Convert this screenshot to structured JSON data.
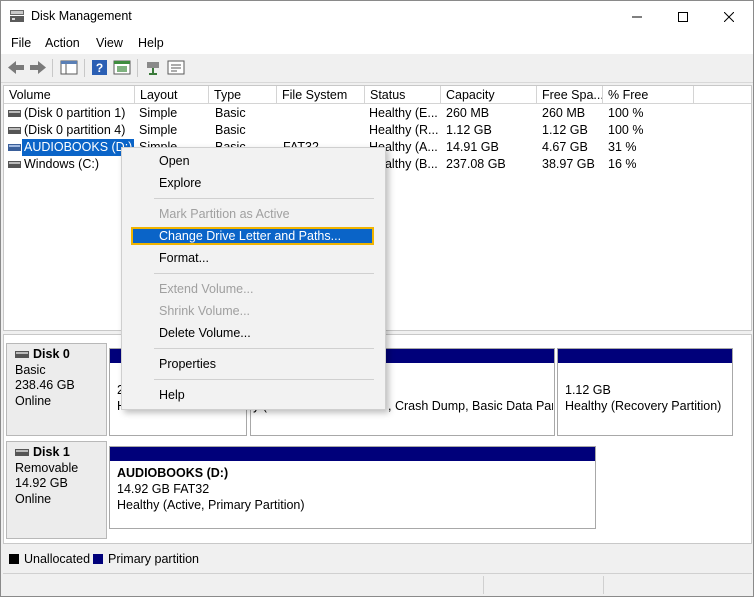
{
  "window": {
    "title": "Disk Management"
  },
  "menubar": [
    "File",
    "Action",
    "View",
    "Help"
  ],
  "volume_list": {
    "columns": [
      "Volume",
      "Layout",
      "Type",
      "File System",
      "Status",
      "Capacity",
      "Free Spa...",
      "% Free"
    ],
    "rows": [
      {
        "volume": "(Disk 0 partition 1)",
        "layout": "Simple",
        "type": "Basic",
        "fs": "",
        "status": "Healthy (E...",
        "capacity": "260 MB",
        "free": "260 MB",
        "pct": "100 %"
      },
      {
        "volume": "(Disk 0 partition 4)",
        "layout": "Simple",
        "type": "Basic",
        "fs": "",
        "status": "Healthy (R...",
        "capacity": "1.12 GB",
        "free": "1.12 GB",
        "pct": "100 %"
      },
      {
        "volume": "AUDIOBOOKS (D:)",
        "layout": "Simple",
        "type": "Basic",
        "fs": "FAT32",
        "status": "Healthy (A...",
        "capacity": "14.91 GB",
        "free": "4.67 GB",
        "pct": "31 %"
      },
      {
        "volume": "Windows (C:)",
        "layout": "",
        "type": "",
        "fs": "",
        "status": "Healthy (B...",
        "capacity": "237.08 GB",
        "free": "38.97 GB",
        "pct": "16 %"
      }
    ]
  },
  "context_menu": {
    "open": "Open",
    "explore": "Explore",
    "mark_active": "Mark Partition as Active",
    "change_letter": "Change Drive Letter and Paths...",
    "format": "Format...",
    "extend": "Extend Volume...",
    "shrink": "Shrink Volume...",
    "delete": "Delete Volume...",
    "properties": "Properties",
    "help": "Help"
  },
  "disks": [
    {
      "name": "Disk 0",
      "kind": "Basic",
      "size": "238.46 GB",
      "state": "Online",
      "partitions": [
        {
          "line1": "2",
          "line2": "He"
        },
        {
          "line2": "y (...",
          "line2b": ", Crash Dump, Basic Data Partiti"
        },
        {
          "line1": "1.12 GB",
          "line2": "Healthy (Recovery Partition)"
        }
      ]
    },
    {
      "name": "Disk 1",
      "kind": "Removable",
      "size": "14.92 GB",
      "state": "Online",
      "partitions": [
        {
          "title": "AUDIOBOOKS  (D:)",
          "line1": "14.92 GB FAT32",
          "line2": "Healthy (Active, Primary Partition)"
        }
      ]
    }
  ],
  "legend": {
    "unallocated": "Unallocated",
    "primary": "Primary partition"
  },
  "colors": {
    "primary_bar": "#00007a",
    "selection": "#0a64c8",
    "focus_border": "#f0b400",
    "unallocated": "#000000"
  },
  "icons": [
    "disk-management-icon",
    "back-arrow-icon",
    "forward-arrow-icon",
    "console-tree-icon",
    "help-icon",
    "action-pane-icon",
    "connect-icon",
    "settings-icon",
    "drive-icon",
    "disk-icon"
  ]
}
